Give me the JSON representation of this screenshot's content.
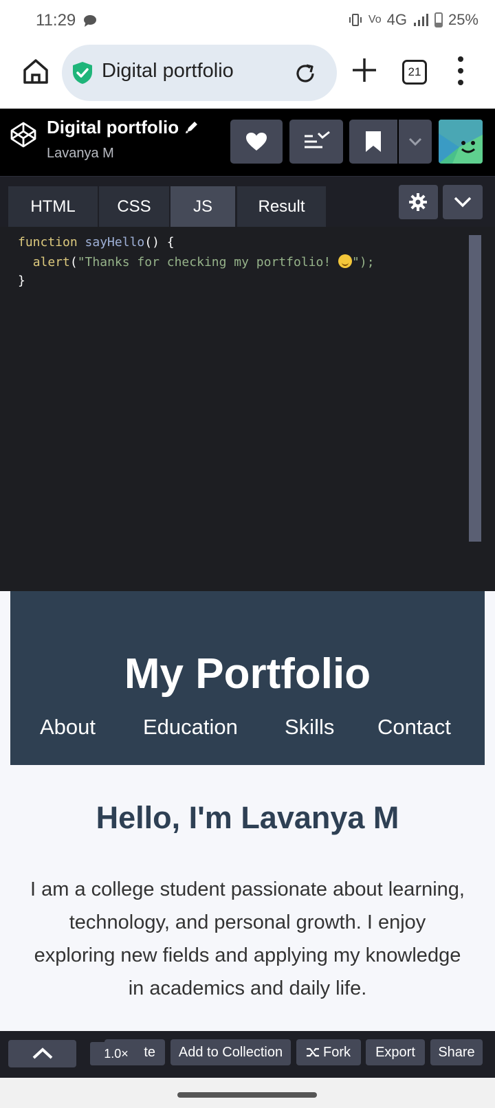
{
  "status": {
    "time": "11:29",
    "network": "4G",
    "battery": "25%"
  },
  "browser": {
    "url_text": "Digital portfolio",
    "tab_count": "21"
  },
  "pen": {
    "title": "Digital portfolio",
    "author": "Lavanya M"
  },
  "editor": {
    "tabs": [
      "HTML",
      "CSS",
      "JS",
      "Result"
    ],
    "active_tab": "JS",
    "code": {
      "l1_kw": "function",
      "l1_fn": "sayHello",
      "l1_rest": "() {",
      "l2_call": "alert",
      "l2_str": "\"Thanks for checking my portfolio! ",
      "l2_end": "\");",
      "l3": "}"
    }
  },
  "preview": {
    "hero_title": "My Portfolio",
    "nav": [
      "About",
      "Education",
      "Skills",
      "Contact"
    ],
    "greeting": "Hello, I'm Lavanya M",
    "bio": "I am a college student passionate about learning, technology, and personal growth. I enjoy exploring new fields and applying my knowledge in academics and daily life."
  },
  "toolbar": {
    "zoom": "1.0×",
    "delete_partial": "te",
    "add_collection": "Add to Collection",
    "fork": "Fork",
    "export": "Export",
    "share": "Share"
  },
  "colors": {
    "hero_bg": "#2f4052",
    "editor_bg": "#1d1e22",
    "button_bg": "#444857",
    "shield_green": "#1fb57a"
  }
}
